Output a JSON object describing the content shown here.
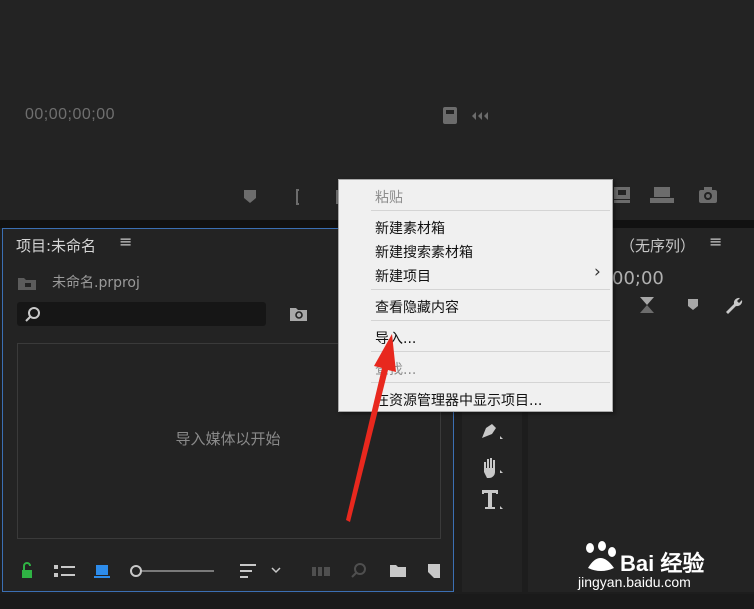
{
  "source_monitor": {
    "timecode": "00;00;00;00"
  },
  "project_panel": {
    "title": "项目:未命名",
    "menu_glyph": "≡",
    "file_name": "未命名.prproj",
    "search_placeholder": "",
    "empty_hint": "导入媒体以开始"
  },
  "program_panel": {
    "title": "（无序列）",
    "menu_glyph": "≡",
    "timecode": "00;00"
  },
  "context_menu": {
    "items": [
      {
        "label": "粘贴",
        "enabled": false
      },
      {
        "label": "新建素材箱",
        "enabled": true
      },
      {
        "label": "新建搜索素材箱",
        "enabled": true
      },
      {
        "label": "新建项目",
        "enabled": true,
        "submenu": true
      },
      {
        "label": "查看隐藏内容",
        "enabled": true
      },
      {
        "label": "导入...",
        "enabled": true
      },
      {
        "label": "查找...",
        "enabled": false
      },
      {
        "label": "在资源管理器中显示项目...",
        "enabled": true
      }
    ],
    "submenu_glyph": "›"
  },
  "watermark": {
    "brand": "Bai 经验",
    "url": "jingyan.baidu.com"
  },
  "colors": {
    "panel": "#232323",
    "focus_border": "#3b6fb3",
    "menu_bg": "#f0f0f0",
    "arrow": "#e8281e",
    "lock_green": "#2fb344",
    "list_blue": "#2d8ceb"
  }
}
